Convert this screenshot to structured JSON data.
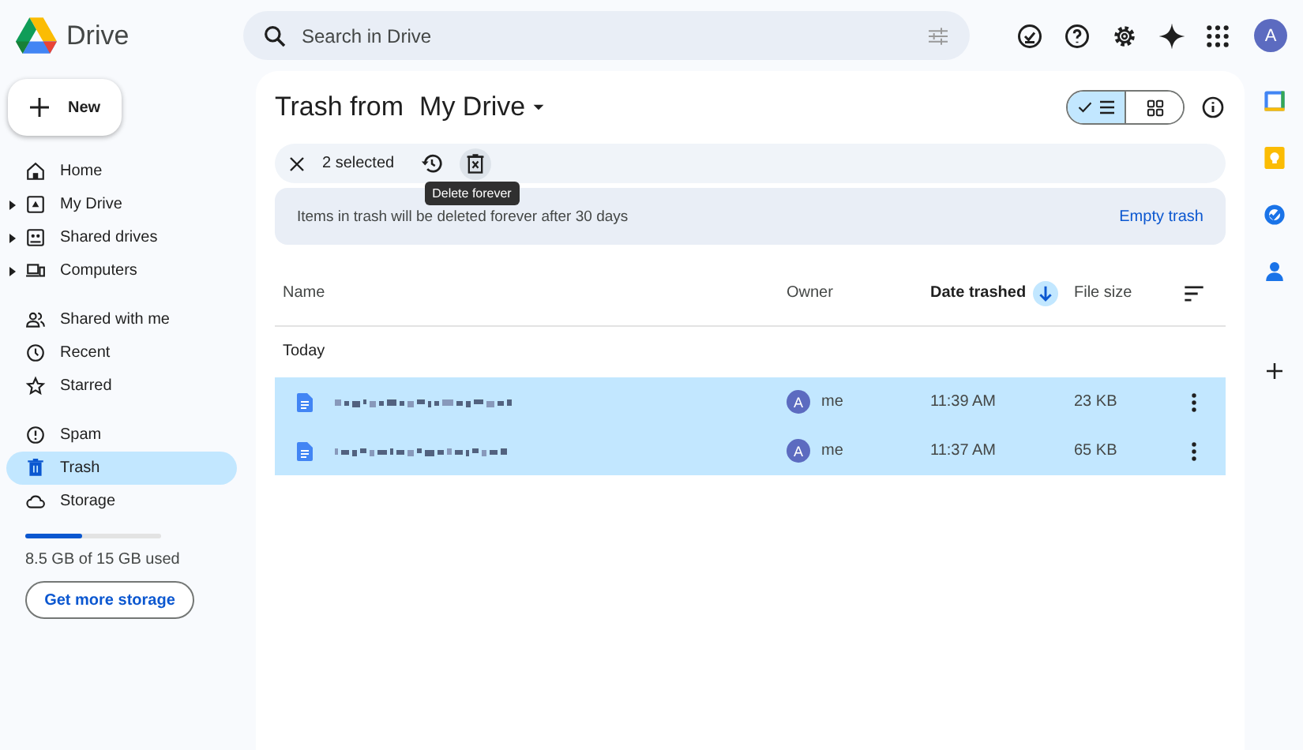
{
  "app": {
    "name": "Drive"
  },
  "search": {
    "placeholder": "Search in Drive"
  },
  "account": {
    "initial": "A"
  },
  "new_button": "New",
  "sidebar": {
    "sections": [
      [
        {
          "label": "Home",
          "expandable": false,
          "selected": false
        },
        {
          "label": "My Drive",
          "expandable": true,
          "selected": false
        },
        {
          "label": "Shared drives",
          "expandable": true,
          "selected": false
        },
        {
          "label": "Computers",
          "expandable": true,
          "selected": false
        }
      ],
      [
        {
          "label": "Shared with me",
          "expandable": false,
          "selected": false
        },
        {
          "label": "Recent",
          "expandable": false,
          "selected": false
        },
        {
          "label": "Starred",
          "expandable": false,
          "selected": false
        }
      ],
      [
        {
          "label": "Spam",
          "expandable": false,
          "selected": false
        },
        {
          "label": "Trash",
          "expandable": false,
          "selected": true
        },
        {
          "label": "Storage",
          "expandable": false,
          "selected": false
        }
      ]
    ]
  },
  "storage": {
    "level": 0.42,
    "text": "8.5 GB of 15 GB used",
    "button": "Get more storage"
  },
  "title": {
    "prefix": "Trash from",
    "location": "My Drive"
  },
  "view_toggle": [
    {
      "kind": "list",
      "selected": true
    },
    {
      "kind": "grid",
      "selected": false
    }
  ],
  "selection_bar": {
    "count": "2 selected",
    "tooltip": "Delete forever"
  },
  "banner": {
    "text": "Items in trash will be deleted forever after 30 days",
    "action": "Empty trash"
  },
  "table": {
    "columns": [
      "Name",
      "Owner",
      "Date trashed",
      "File size"
    ],
    "group": "Today",
    "rows": [
      {
        "owner_initial": "A",
        "owner": "me",
        "date": "11:39 AM",
        "size": "23 KB",
        "selected": true
      },
      {
        "owner_initial": "A",
        "owner": "me",
        "date": "11:37 AM",
        "size": "65 KB",
        "selected": true
      }
    ]
  }
}
